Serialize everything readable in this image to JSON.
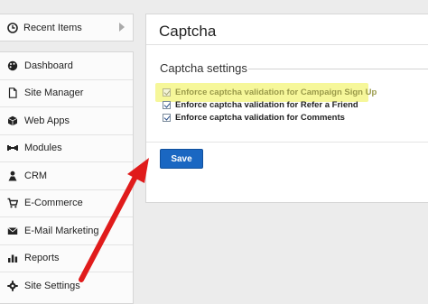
{
  "recent": {
    "label": "Recent Items"
  },
  "nav": {
    "items": [
      {
        "label": "Dashboard",
        "icon": "palette-icon"
      },
      {
        "label": "Site Manager",
        "icon": "document-icon"
      },
      {
        "label": "Web Apps",
        "icon": "cube-icon"
      },
      {
        "label": "Modules",
        "icon": "puzzle-icon"
      },
      {
        "label": "CRM",
        "icon": "user-icon"
      },
      {
        "label": "E-Commerce",
        "icon": "cart-icon"
      },
      {
        "label": "E-Mail Marketing",
        "icon": "envelope-icon"
      },
      {
        "label": "Reports",
        "icon": "bar-chart-icon"
      },
      {
        "label": "Site Settings",
        "icon": "gear-icon"
      }
    ]
  },
  "panel": {
    "title": "Captcha",
    "section_title": "Captcha settings",
    "options": [
      {
        "label": "Enforce captcha validation for Campaign Sign Up",
        "checked": true,
        "highlighted": true
      },
      {
        "label": "Enforce captcha validation for Refer a Friend",
        "checked": true,
        "highlighted": false
      },
      {
        "label": "Enforce captcha validation for Comments",
        "checked": true,
        "highlighted": false
      }
    ],
    "save_label": "Save"
  },
  "colors": {
    "highlight": "#f6f79a",
    "save_button": "#1a67c2",
    "arrow": "#e01b1b"
  }
}
